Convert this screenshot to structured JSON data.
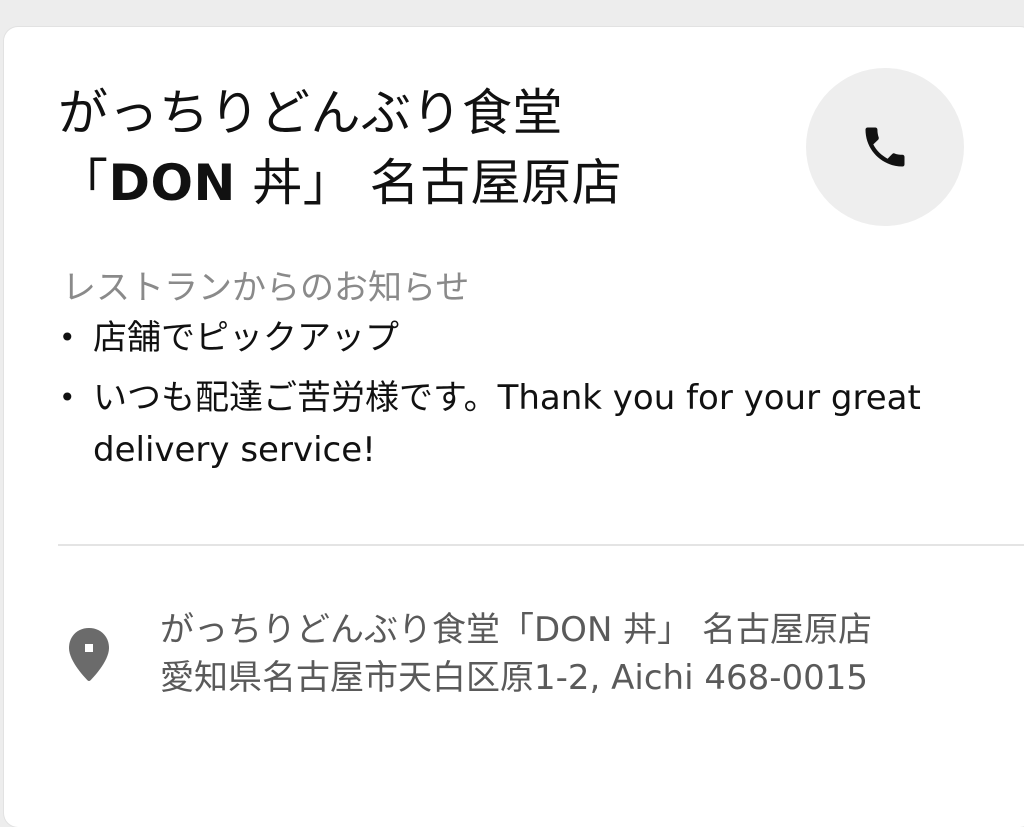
{
  "restaurant": {
    "name_line1": "がっちりどんぶり食堂",
    "name_line2_open": "「",
    "name_line2_ascii": "DON",
    "name_line2_rest": " 丼」 名古屋原店"
  },
  "actions": {
    "call_icon": "phone-icon"
  },
  "notice": {
    "heading": "レストランからのお知らせ",
    "items": [
      "店舗でピックアップ",
      "いつも配達ご苦労様です。Thank you for your great delivery service!"
    ]
  },
  "location": {
    "icon": "location-pin-icon",
    "name": "がっちりどんぶり食堂「DON 丼」 名古屋原店",
    "address": "愛知県名古屋市天白区原1-2, Aichi 468-0015"
  },
  "colors": {
    "card": "#ffffff",
    "page": "#ededed",
    "text": "#111111",
    "muted": "#8a8a8a",
    "address": "#5a5a5a",
    "call_button_bg": "#eeeeee",
    "pin": "#6b6b6b"
  }
}
